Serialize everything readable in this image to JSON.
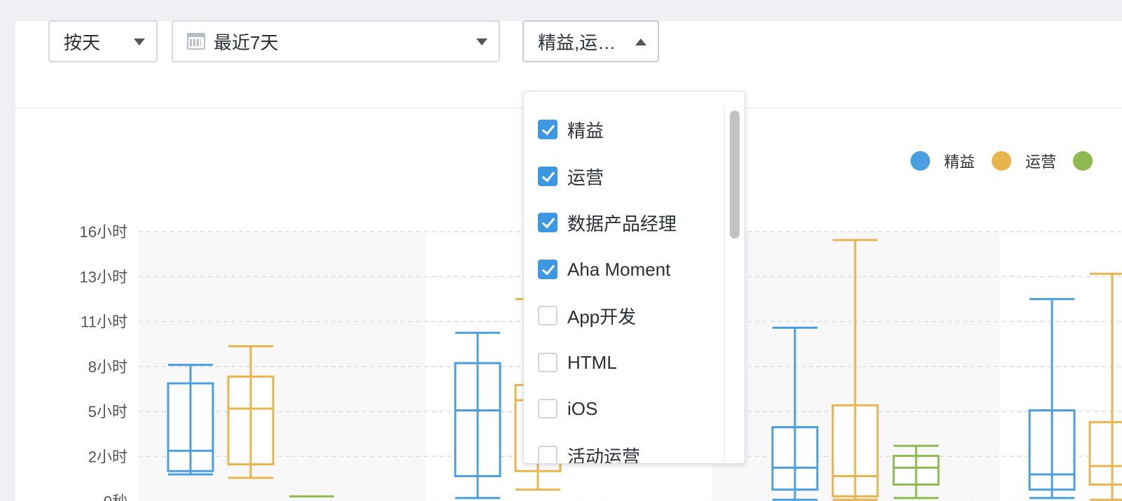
{
  "filters": {
    "granularity": "按天",
    "date_range": "最近7天",
    "group_select": "精益,运…"
  },
  "dropdown": {
    "options": [
      {
        "label": "精益",
        "checked": true
      },
      {
        "label": "运营",
        "checked": true
      },
      {
        "label": "数据产品经理",
        "checked": true
      },
      {
        "label": "Aha Moment",
        "checked": true
      },
      {
        "label": "App开发",
        "checked": false
      },
      {
        "label": "HTML",
        "checked": false
      },
      {
        "label": "iOS",
        "checked": false
      },
      {
        "label": "活动运营",
        "checked": false
      }
    ]
  },
  "legend": [
    {
      "label": "精益",
      "color": "#4a9fe0"
    },
    {
      "label": "运营",
      "color": "#e9b44c"
    },
    {
      "label": "",
      "color": "#8ebb4f"
    }
  ],
  "chart_data": {
    "type": "boxplot",
    "y_unit": "hours",
    "y_ticks": [
      "0秒",
      "2小时",
      "5小时",
      "8小时",
      "11小时",
      "13小时",
      "16小时"
    ],
    "y_tick_values": [
      0,
      2.67,
      5.33,
      8,
      10.67,
      13.33,
      16
    ],
    "grid": true,
    "legend_position": "top-right",
    "series_colors": [
      "#4a9fe0",
      "#e9b44c",
      "#8ebb4f"
    ],
    "boxes": [
      {
        "group": 1,
        "series": 0,
        "min": 1.6,
        "q1": 1.8,
        "median": 3.0,
        "q3": 7.0,
        "max": 8.1
      },
      {
        "group": 1,
        "series": 1,
        "min": 1.4,
        "q1": 2.2,
        "median": 5.5,
        "q3": 7.4,
        "max": 9.2
      },
      {
        "group": 1,
        "series": 2,
        "min": 0.3,
        "q1": 0.3,
        "median": 0.3,
        "q3": 0.3,
        "max": 0.3
      },
      {
        "group": 2,
        "series": 0,
        "min": 0.2,
        "q1": 1.5,
        "median": 5.4,
        "q3": 8.2,
        "max": 10.0
      },
      {
        "group": 2,
        "series": 1,
        "min": 0.7,
        "q1": 1.8,
        "median": 6.0,
        "q3": 6.9,
        "max": 12.0
      },
      {
        "group": 3,
        "series": 0,
        "min": 0.1,
        "q1": 0.7,
        "median": 2.0,
        "q3": 4.4,
        "max": 10.3
      },
      {
        "group": 3,
        "series": 1,
        "min": 0.1,
        "q1": 0.3,
        "median": 1.5,
        "q3": 5.7,
        "max": 15.5
      },
      {
        "group": 3,
        "series": 2,
        "min": 0.2,
        "q1": 1.0,
        "median": 2.0,
        "q3": 2.7,
        "max": 3.3
      },
      {
        "group": 4,
        "series": 0,
        "min": 0.2,
        "q1": 0.7,
        "median": 1.6,
        "q3": 5.4,
        "max": 12.0
      },
      {
        "group": 4,
        "series": 1,
        "min": 0.1,
        "q1": 1.0,
        "median": 2.1,
        "q3": 4.7,
        "max": 13.5
      }
    ]
  }
}
